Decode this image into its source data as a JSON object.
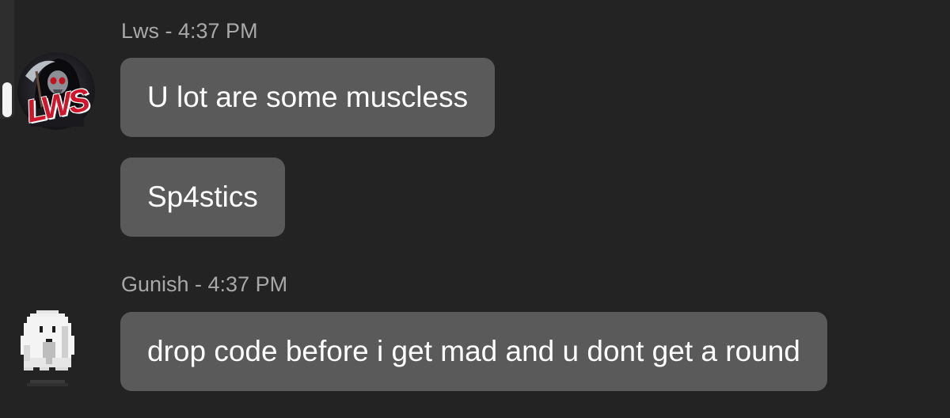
{
  "messages": [
    {
      "author": "Lws",
      "time": "4:37 PM",
      "header": "Lws - 4:37 PM",
      "avatar_icon": "reaper-logo-avatar",
      "avatar_text": "LWS",
      "lines": [
        "U lot are some muscless",
        "Sp4stics"
      ]
    },
    {
      "author": "Gunish",
      "time": "4:37 PM",
      "header": "Gunish - 4:37 PM",
      "avatar_icon": "pixel-ghost-avatar",
      "lines": [
        "drop code before i get mad and u dont get a round"
      ]
    }
  ],
  "colors": {
    "background": "#232323",
    "bubble": "#5a5a5a",
    "header_text": "#a8a8a8",
    "message_text": "#ffffff",
    "logo_red": "#d0162a"
  }
}
